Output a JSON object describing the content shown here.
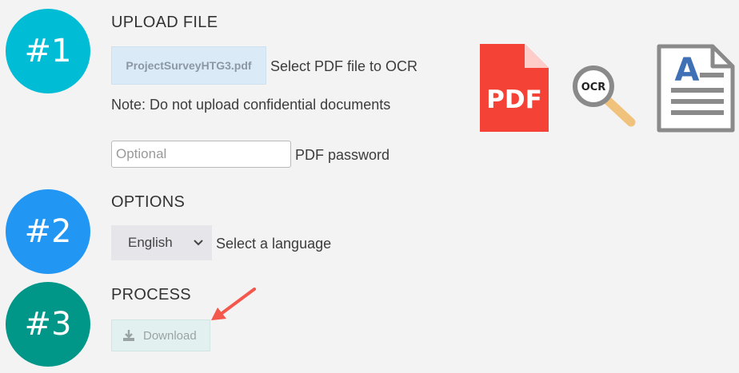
{
  "steps": [
    {
      "number": "#1",
      "heading": "UPLOAD FILE",
      "color": "#00bcd4"
    },
    {
      "number": "#2",
      "heading": "OPTIONS",
      "color": "#2196f3"
    },
    {
      "number": "#3",
      "heading": "PROCESS",
      "color": "#009688"
    }
  ],
  "upload": {
    "file_name": "ProjectSurveyHTG3.pdf",
    "select_label": "Select PDF file to OCR",
    "note": "Note: Do not upload confidential documents",
    "password_placeholder": "Optional",
    "password_label": "PDF password"
  },
  "options": {
    "language_value": "English",
    "language_label": "Select a language"
  },
  "process": {
    "download_label": "Download"
  },
  "illustration": {
    "pdf_icon_text": "PDF",
    "ocr_icon_text": "OCR",
    "doc_icon_letter": "A",
    "pdf_color": "#f44336",
    "arrow_color": "#f4574b"
  }
}
